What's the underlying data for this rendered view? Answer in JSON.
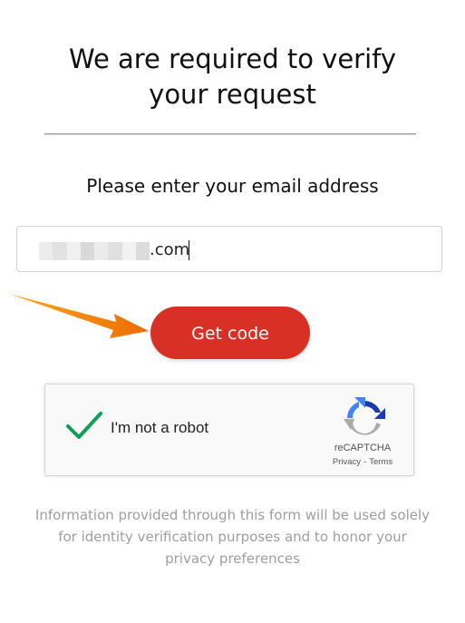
{
  "heading": {
    "line1": "We are required to verify",
    "line2": "your request"
  },
  "prompt": "Please enter your email address",
  "email_field": {
    "visible_value": ".com",
    "redacted": true
  },
  "get_code_button": {
    "label": "Get code",
    "color": "#d93025"
  },
  "recaptcha": {
    "checkbox_label": "I'm not a robot",
    "checked": true,
    "brand": "reCAPTCHA",
    "privacy_link": "Privacy",
    "separator": "-",
    "terms_link": "Terms",
    "check_color": "#0f9d58"
  },
  "footer": {
    "line1": "Information provided through this form will be used solely",
    "line2": "for identity verification purposes and to honor your",
    "line3": "privacy preferences"
  },
  "annotation": {
    "arrow_icon": "arrow-right-icon",
    "arrow_color": "#f57c00"
  }
}
